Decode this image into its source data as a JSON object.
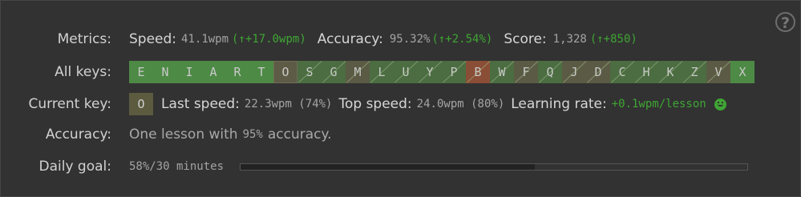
{
  "help": {
    "label": "?"
  },
  "metrics": {
    "label": "Metrics:",
    "speed": {
      "label": "Speed:",
      "value": "41.1wpm",
      "delta": "(↑+17.0wpm)"
    },
    "accuracy": {
      "label": "Accuracy:",
      "value": "95.32%",
      "delta": "(↑+2.54%)"
    },
    "score": {
      "label": "Score:",
      "value": "1,328",
      "delta": "(↑+850)"
    }
  },
  "all_keys": {
    "label": "All keys:",
    "keys": [
      {
        "letter": "E",
        "state": "learned"
      },
      {
        "letter": "N",
        "state": "learned"
      },
      {
        "letter": "I",
        "state": "learned"
      },
      {
        "letter": "A",
        "state": "learned"
      },
      {
        "letter": "R",
        "state": "learned"
      },
      {
        "letter": "T",
        "state": "learned"
      },
      {
        "letter": "O",
        "state": "current"
      },
      {
        "letter": "S",
        "state": "in-progress"
      },
      {
        "letter": "G",
        "state": "in-progress"
      },
      {
        "letter": "M",
        "state": "in-progress-warn"
      },
      {
        "letter": "L",
        "state": "in-progress"
      },
      {
        "letter": "U",
        "state": "in-progress"
      },
      {
        "letter": "Y",
        "state": "in-progress"
      },
      {
        "letter": "P",
        "state": "in-progress"
      },
      {
        "letter": "B",
        "state": "bad"
      },
      {
        "letter": "W",
        "state": "in-progress"
      },
      {
        "letter": "F",
        "state": "in-progress-warn"
      },
      {
        "letter": "Q",
        "state": "in-progress"
      },
      {
        "letter": "J",
        "state": "in-progress-warn"
      },
      {
        "letter": "D",
        "state": "in-progress-warn"
      },
      {
        "letter": "C",
        "state": "in-progress"
      },
      {
        "letter": "H",
        "state": "in-progress"
      },
      {
        "letter": "K",
        "state": "in-progress"
      },
      {
        "letter": "Z",
        "state": "in-progress"
      },
      {
        "letter": "V",
        "state": "in-progress-warn"
      },
      {
        "letter": "X",
        "state": "learned"
      }
    ]
  },
  "current_key": {
    "label": "Current key:",
    "key": "O",
    "last_speed_label": "Last speed:",
    "last_speed_value": "22.3wpm (74%)",
    "top_speed_label": "Top speed:",
    "top_speed_value": "24.0wpm (80%)",
    "learning_rate_label": "Learning rate:",
    "learning_rate_value": "+0.1wpm/lesson",
    "mood_icon": "smiley-icon",
    "accent": "#3fa534"
  },
  "accuracy": {
    "label": "Accuracy:",
    "text_before": "One lesson with",
    "value": "95%",
    "text_after": "accuracy."
  },
  "daily_goal": {
    "label": "Daily goal:",
    "value": "58%/30 minutes",
    "progress_fraction": 0.58
  }
}
